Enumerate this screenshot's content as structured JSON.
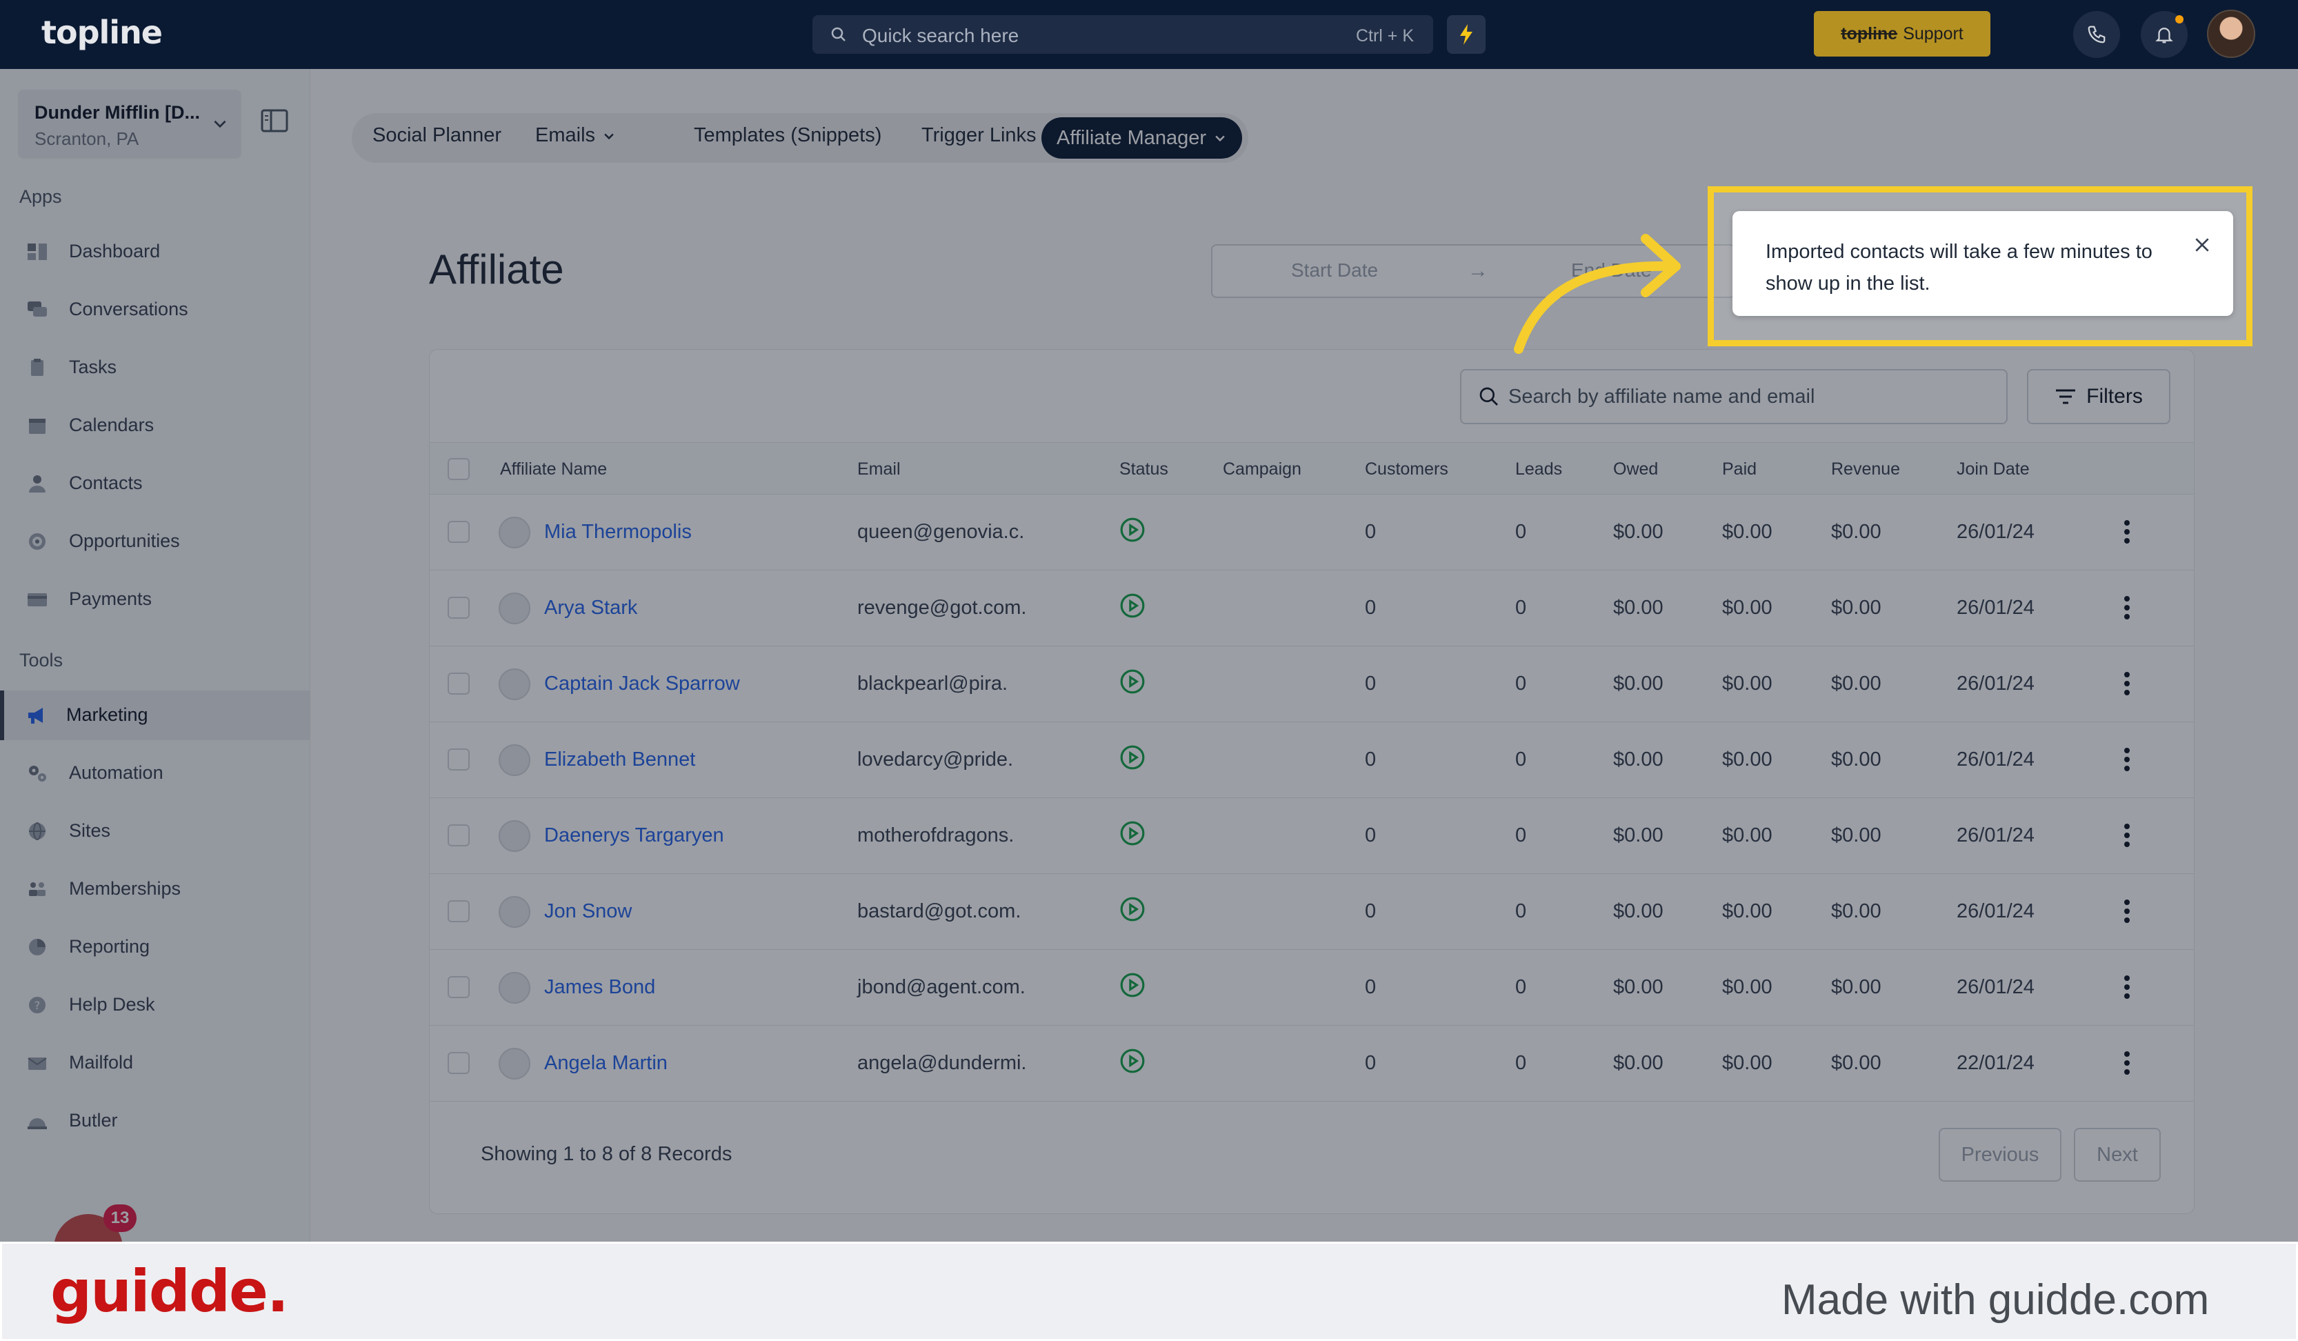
{
  "header": {
    "logo": "topline",
    "search_placeholder": "Quick search here",
    "search_shortcut": "Ctrl + K",
    "support_brand": "topline",
    "support_label": "Support"
  },
  "sidebar": {
    "account_name": "Dunder Mifflin [D...",
    "account_location": "Scranton, PA",
    "apps_label": "Apps",
    "apps": [
      {
        "label": "Dashboard",
        "icon": "dashboard-icon"
      },
      {
        "label": "Conversations",
        "icon": "chat-icon"
      },
      {
        "label": "Tasks",
        "icon": "clipboard-icon"
      },
      {
        "label": "Calendars",
        "icon": "calendar-icon"
      },
      {
        "label": "Contacts",
        "icon": "person-icon"
      },
      {
        "label": "Opportunities",
        "icon": "target-icon"
      },
      {
        "label": "Payments",
        "icon": "card-icon"
      }
    ],
    "tools_label": "Tools",
    "tools": [
      {
        "label": "Marketing",
        "icon": "megaphone-icon"
      },
      {
        "label": "Automation",
        "icon": "gears-icon"
      },
      {
        "label": "Sites",
        "icon": "globe-icon"
      },
      {
        "label": "Memberships",
        "icon": "users-icon"
      },
      {
        "label": "Reporting",
        "icon": "pie-chart-icon"
      },
      {
        "label": "Help Desk",
        "icon": "help-icon"
      },
      {
        "label": "Mailfold",
        "icon": "mail-icon"
      },
      {
        "label": "Butler",
        "icon": "bell-hat-icon"
      }
    ],
    "badge_count": "13"
  },
  "tabs": [
    {
      "label": "Social Planner"
    },
    {
      "label": "Emails"
    },
    {
      "label": "Templates (Snippets)"
    },
    {
      "label": "Trigger Links"
    },
    {
      "label": "Affiliate Manager"
    }
  ],
  "page": {
    "title": "Affiliate",
    "start_date_placeholder": "Start Date",
    "end_date_placeholder": "End Date",
    "search_placeholder": "Search by affiliate name and email",
    "filters_label": "Filters"
  },
  "table": {
    "columns": [
      "Affiliate Name",
      "Email",
      "Status",
      "Campaign",
      "Customers",
      "Leads",
      "Owed",
      "Paid",
      "Revenue",
      "Join Date"
    ],
    "rows": [
      {
        "name": "Mia Thermopolis",
        "email": "queen@genovia.c.",
        "customers": "0",
        "leads": "0",
        "owed": "$0.00",
        "paid": "$0.00",
        "revenue": "$0.00",
        "join": "26/01/24"
      },
      {
        "name": "Arya Stark",
        "email": "revenge@got.com.",
        "customers": "0",
        "leads": "0",
        "owed": "$0.00",
        "paid": "$0.00",
        "revenue": "$0.00",
        "join": "26/01/24"
      },
      {
        "name": "Captain Jack Sparrow",
        "email": "blackpearl@pira.",
        "customers": "0",
        "leads": "0",
        "owed": "$0.00",
        "paid": "$0.00",
        "revenue": "$0.00",
        "join": "26/01/24"
      },
      {
        "name": "Elizabeth Bennet",
        "email": "lovedarcy@pride.",
        "customers": "0",
        "leads": "0",
        "owed": "$0.00",
        "paid": "$0.00",
        "revenue": "$0.00",
        "join": "26/01/24"
      },
      {
        "name": "Daenerys Targaryen",
        "email": "motherofdragons.",
        "customers": "0",
        "leads": "0",
        "owed": "$0.00",
        "paid": "$0.00",
        "revenue": "$0.00",
        "join": "26/01/24"
      },
      {
        "name": "Jon Snow",
        "email": "bastard@got.com.",
        "customers": "0",
        "leads": "0",
        "owed": "$0.00",
        "paid": "$0.00",
        "revenue": "$0.00",
        "join": "26/01/24"
      },
      {
        "name": "James Bond",
        "email": "jbond@agent.com.",
        "customers": "0",
        "leads": "0",
        "owed": "$0.00",
        "paid": "$0.00",
        "revenue": "$0.00",
        "join": "26/01/24"
      },
      {
        "name": "Angela Martin",
        "email": "angela@dundermi.",
        "customers": "0",
        "leads": "0",
        "owed": "$0.00",
        "paid": "$0.00",
        "revenue": "$0.00",
        "join": "22/01/24"
      }
    ],
    "showing": "Showing 1 to 8 of 8 Records",
    "prev_label": "Previous",
    "next_label": "Next"
  },
  "toast": {
    "message": "Imported contacts will take a few minutes to show up in the  list."
  },
  "footer": {
    "brand": "guidde.",
    "tagline": "Made with guidde.com"
  },
  "colors": {
    "topbar": "#0b1a33",
    "support_button": "#b59122",
    "highlight": "#f5cd2d",
    "status_active": "#16a34a",
    "link": "#2563eb",
    "brand_red": "#c81414"
  }
}
